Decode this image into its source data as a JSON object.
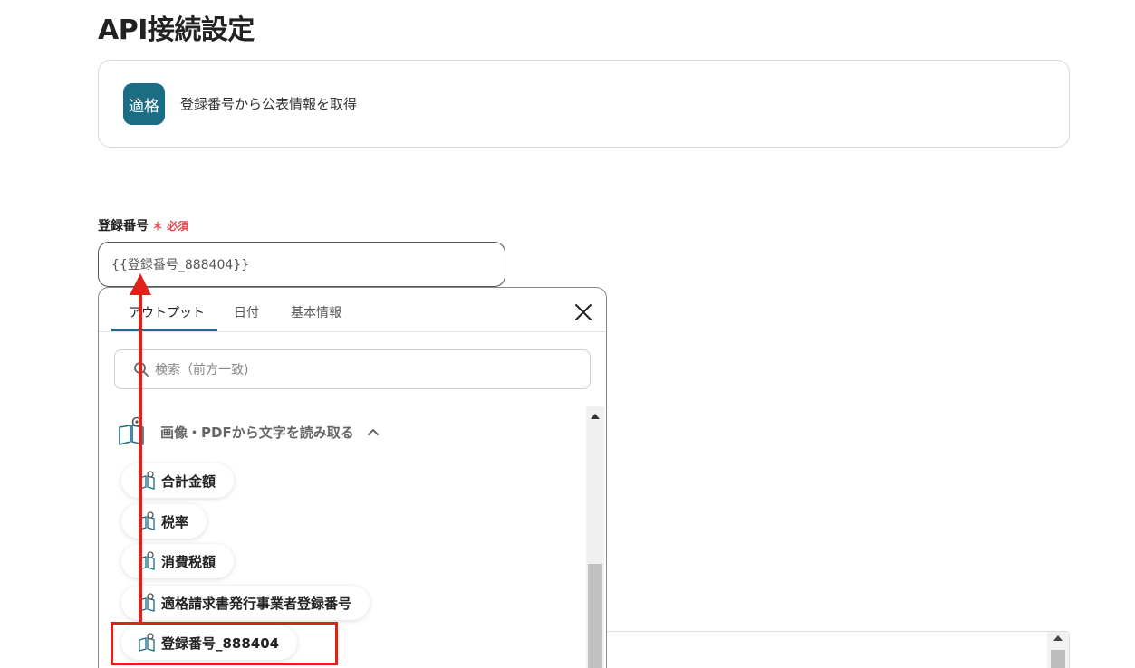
{
  "page": {
    "title": "API接続設定"
  },
  "app_card": {
    "icon_text": "適格",
    "description": "登録番号から公表情報を取得"
  },
  "field": {
    "label": "登録番号",
    "required_marker": "＊ 必須",
    "value": "{{登録番号_888404}}"
  },
  "dropdown": {
    "tabs": [
      {
        "label": "アウトプット",
        "active": true
      },
      {
        "label": "日付",
        "active": false
      },
      {
        "label": "基本情報",
        "active": false
      }
    ],
    "search_placeholder": "検索（前方一致)",
    "group": {
      "label": "画像・PDFから文字を読み取る",
      "expanded": true
    },
    "items": [
      {
        "label": "合計金額"
      },
      {
        "label": "税率"
      },
      {
        "label": "消費税額"
      },
      {
        "label": "適格請求書発行事業者登録番号"
      },
      {
        "label": "登録番号_888404",
        "highlighted": true
      }
    ]
  },
  "colors": {
    "accent": "#1b6d84",
    "required": "#e5484d",
    "annotation": "#e0201b"
  },
  "icons": [
    "close-icon",
    "search-icon",
    "ocr-book-icon",
    "chevron-up-icon"
  ]
}
